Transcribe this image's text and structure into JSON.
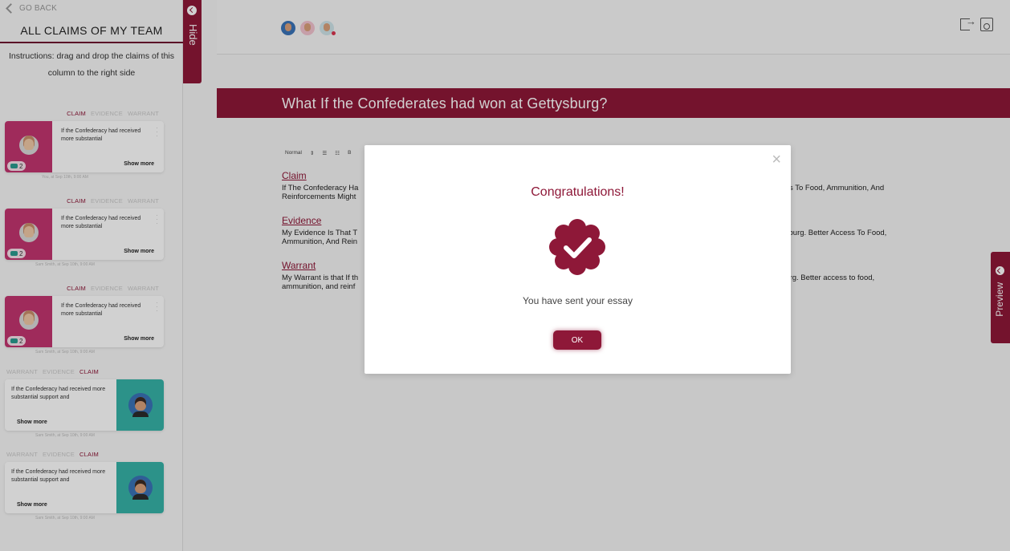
{
  "sidebar": {
    "go_back": "GO BACK",
    "title": "ALL CLAIMS OF MY TEAM",
    "instructions": "Instructions: drag and drop the claims of this column to the right side",
    "hide_label": "Hide",
    "cards": [
      {
        "tabs": [
          "CLAIM",
          "EVIDENCE",
          "WARRANT"
        ],
        "active_tab": "CLAIM",
        "text": "If the Confederacy had received more substantial",
        "show_more": "Show more",
        "badge_count": "2",
        "meta": "You, at Sep 10th, 9:00 AM"
      },
      {
        "tabs": [
          "CLAIM",
          "EVIDENCE",
          "WARRANT"
        ],
        "active_tab": "CLAIM",
        "text": "If the Confederacy had received more substantial",
        "show_more": "Show more",
        "badge_count": "2",
        "meta": "Sam Smith, at Sep 10th, 9:00 AM"
      },
      {
        "tabs": [
          "CLAIM",
          "EVIDENCE",
          "WARRANT"
        ],
        "active_tab": "CLAIM",
        "text": "If the Confederacy had received more substantial",
        "show_more": "Show more",
        "badge_count": "2",
        "meta": "Sam Smith, at Sep 10th, 9:00 AM"
      },
      {
        "tabs": [
          "WARRANT",
          "EVIDENCE",
          "CLAIM"
        ],
        "active_tab": "CLAIM",
        "text": "If the Confederacy had received more substantial support and",
        "show_more": "Show more",
        "meta": "Sam Smith, at Sep 10th, 9:00 AM"
      },
      {
        "tabs": [
          "WARRANT",
          "EVIDENCE",
          "CLAIM"
        ],
        "active_tab": "CLAIM",
        "text": "If the Confederacy had received more substantial support and",
        "show_more": "Show more",
        "meta": "Sam Smith, at Sep 10th, 9:00 AM"
      }
    ]
  },
  "essay": {
    "title": "What If the Confederates had won at Gettysburg?",
    "toolbar": [
      "Normal",
      "⇕",
      "☰",
      "☷",
      "B"
    ],
    "sections": [
      {
        "heading": "Claim",
        "left_lines": [
          "If The Confederacy Ha",
          "Reinforcements Might"
        ],
        "right_lines": [
          "ess To Food, Ammunition, And"
        ]
      },
      {
        "heading": "Evidence",
        "left_lines": [
          "My Evidence Is That  T",
          "Ammunition, And Rein"
        ],
        "right_lines": [
          "ysburg. Better Access To Food,"
        ]
      },
      {
        "heading": "Warrant",
        "left_lines": [
          "My Warrant is that If th",
          "ammunition, and reinf"
        ],
        "right_lines": [
          "burg. Better access to food,"
        ]
      }
    ]
  },
  "preview_label": "Preview",
  "modal": {
    "title": "Congratulations!",
    "message": "You have sent your essay",
    "ok_label": "OK",
    "close_glyph": "×"
  },
  "colors": {
    "brand": "#8e1838",
    "card_pink": "#c3356f",
    "card_teal": "#36b3a8"
  }
}
